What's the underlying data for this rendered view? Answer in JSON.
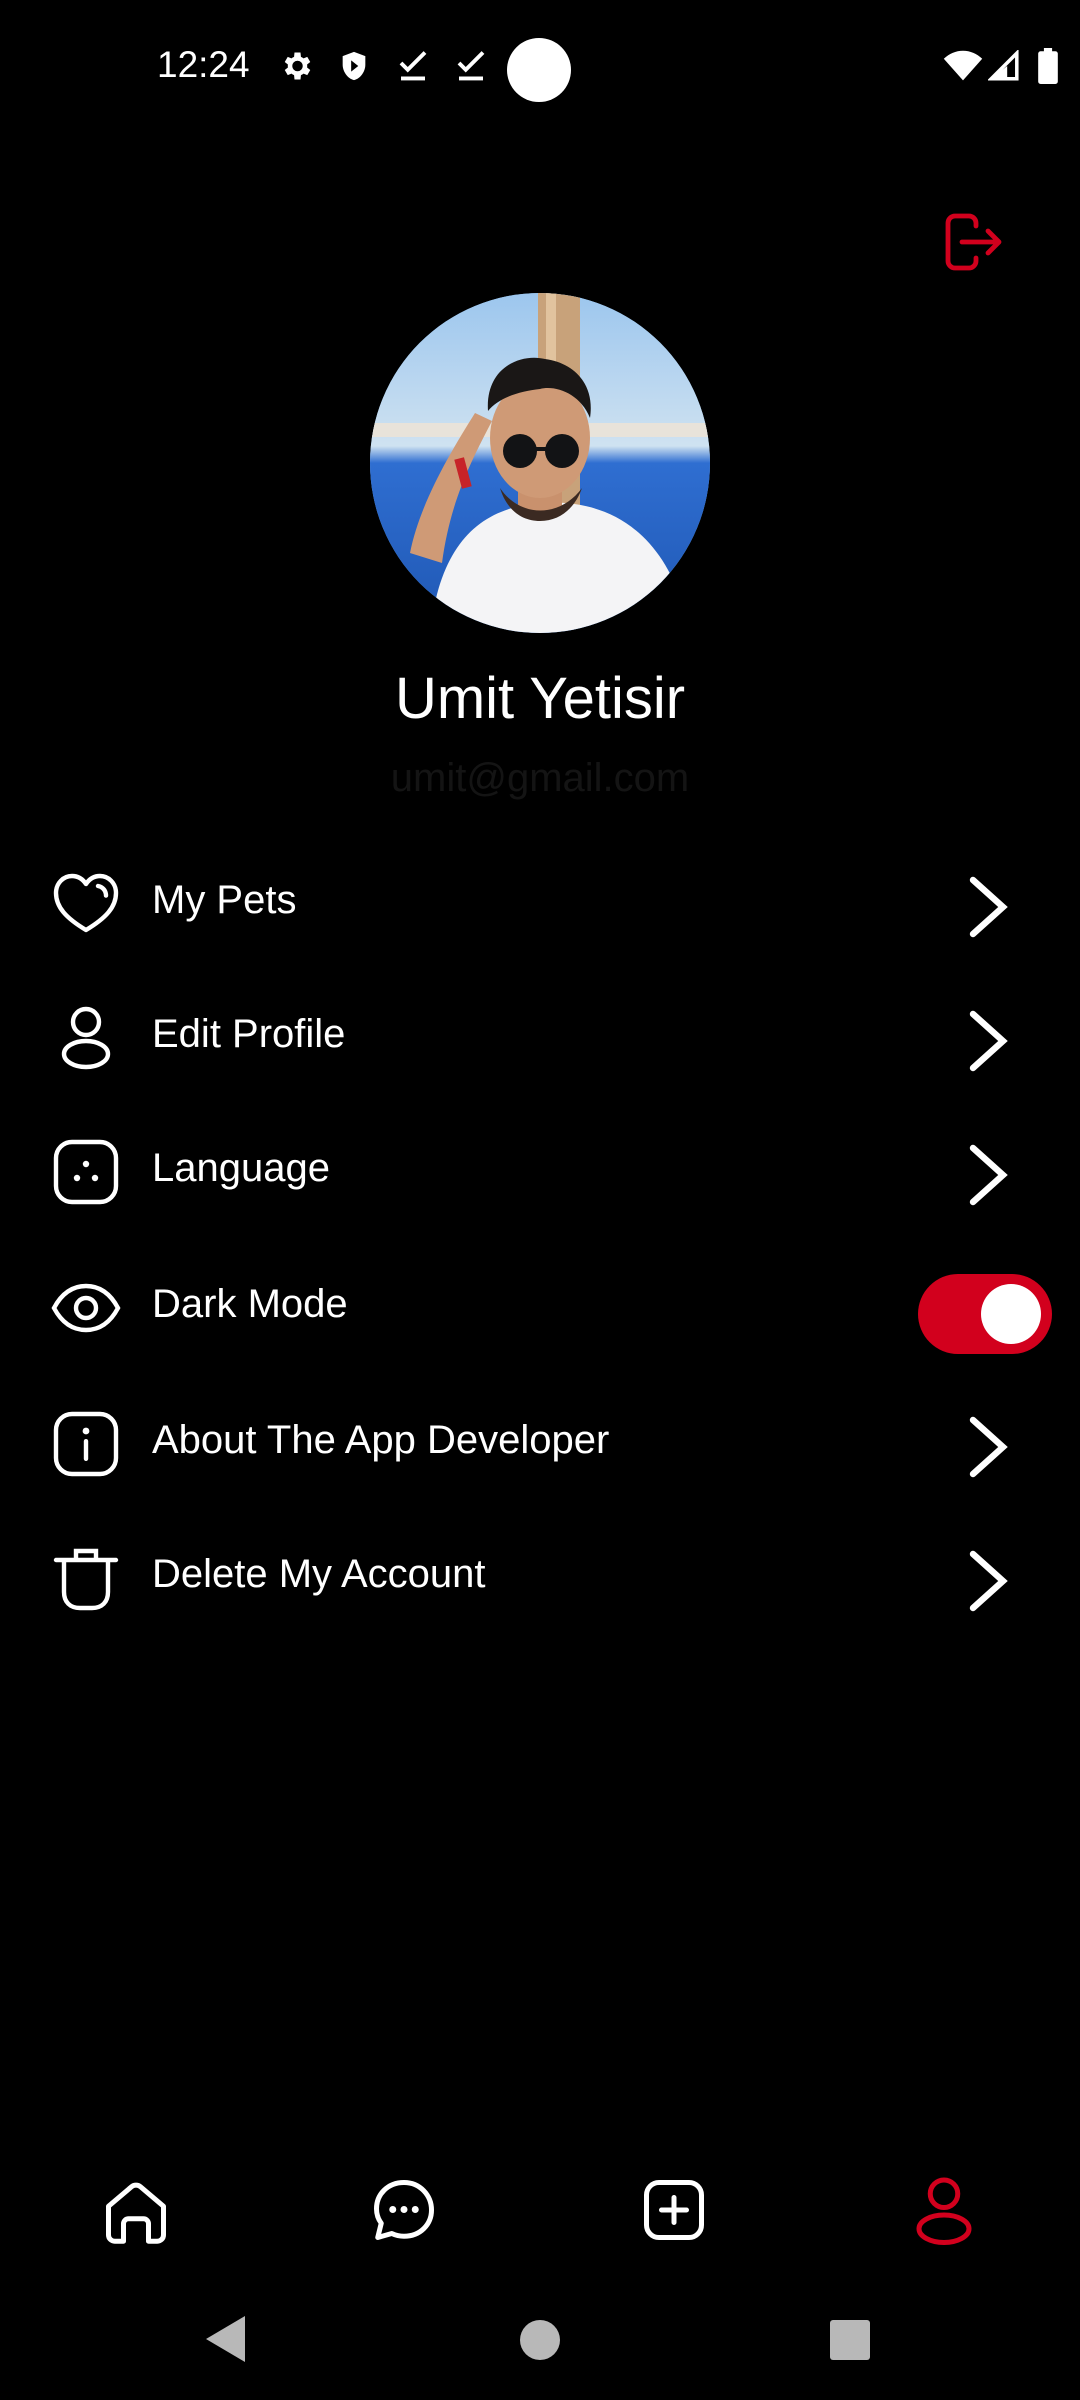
{
  "status_bar": {
    "time": "12:24",
    "icons": [
      "settings-icon",
      "shield-icon",
      "download-done-icon",
      "download-done-icon",
      "notification-dot"
    ],
    "right_icons": [
      "wifi-icon",
      "signal-icon",
      "battery-icon"
    ]
  },
  "header": {
    "logout_icon": "logout-icon"
  },
  "profile": {
    "name": "Umit Yetisir",
    "email": "umit@gmail.com"
  },
  "menu": {
    "items": [
      {
        "label": "My Pets",
        "icon": "heart-icon",
        "action": "chevron"
      },
      {
        "label": "Edit Profile",
        "icon": "user-icon",
        "action": "chevron"
      },
      {
        "label": "Language",
        "icon": "language-icon",
        "action": "chevron"
      },
      {
        "label": "Dark Mode",
        "icon": "eye-icon",
        "action": "toggle",
        "toggle_on": true
      },
      {
        "label": "About The App Developer",
        "icon": "info-icon",
        "action": "chevron"
      },
      {
        "label": "Delete My Account",
        "icon": "trash-icon",
        "action": "chevron"
      }
    ]
  },
  "bottom_nav": {
    "items": [
      {
        "icon": "home-icon",
        "active": false
      },
      {
        "icon": "chat-icon",
        "active": false
      },
      {
        "icon": "add-post-icon",
        "active": false
      },
      {
        "icon": "profile-icon",
        "active": true
      }
    ]
  },
  "colors": {
    "accent": "#d2001d",
    "background": "#000000",
    "text": "#ffffff",
    "muted": "#141414"
  }
}
